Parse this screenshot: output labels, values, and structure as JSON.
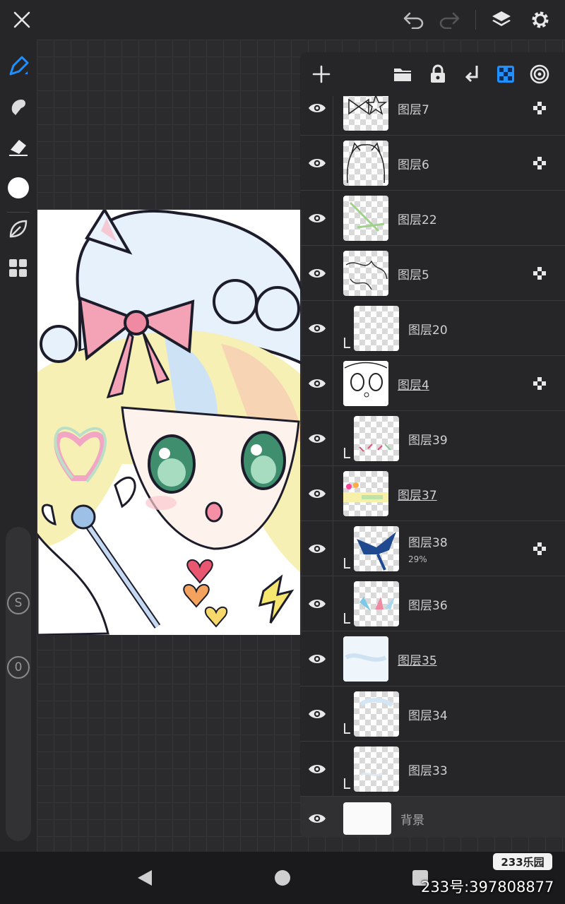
{
  "layers": [
    {
      "name": "图层7",
      "underline": false,
      "clipped": false,
      "alpha_lock": true,
      "thumb": "bow-star-sketch"
    },
    {
      "name": "图层6",
      "underline": false,
      "clipped": false,
      "alpha_lock": true,
      "thumb": "head-outline"
    },
    {
      "name": "图层22",
      "underline": false,
      "clipped": false,
      "alpha_lock": false,
      "thumb": "green-strokes"
    },
    {
      "name": "图层5",
      "underline": false,
      "clipped": false,
      "alpha_lock": true,
      "thumb": "hair-lineart"
    },
    {
      "name": "图层20",
      "underline": false,
      "clipped": true,
      "alpha_lock": false,
      "thumb": "empty"
    },
    {
      "name": "图层4",
      "underline": true,
      "clipped": false,
      "alpha_lock": true,
      "thumb": "face-lineart"
    },
    {
      "name": "图层39",
      "underline": false,
      "clipped": true,
      "alpha_lock": false,
      "thumb": "small-marks"
    },
    {
      "name": "图层37",
      "underline": true,
      "clipped": false,
      "alpha_lock": false,
      "thumb": "rainbow-hearts"
    },
    {
      "name": "图层38",
      "underline": false,
      "clipped": true,
      "alpha_lock": true,
      "thumb": "blue-bow",
      "opacity": "29%"
    },
    {
      "name": "图层36",
      "underline": false,
      "clipped": true,
      "alpha_lock": false,
      "thumb": "colored-wings"
    },
    {
      "name": "图层35",
      "underline": true,
      "clipped": false,
      "alpha_lock": false,
      "thumb": "light-blue"
    },
    {
      "name": "图层34",
      "underline": false,
      "clipped": true,
      "alpha_lock": false,
      "thumb": "light-blue-2"
    },
    {
      "name": "图层33",
      "underline": false,
      "clipped": true,
      "alpha_lock": false,
      "thumb": "faint"
    },
    {
      "name": "背景",
      "underline": false,
      "clipped": false,
      "alpha_lock": false,
      "thumb": "white-bg"
    }
  ],
  "icons": {
    "top": [
      "close-icon",
      "undo-icon",
      "redo-icon",
      "layers-icon",
      "settings-icon"
    ],
    "left": [
      "pen-icon",
      "smudge-icon",
      "eraser-icon",
      "color-icon",
      "leaf-icon",
      "grid-icon"
    ],
    "panel": [
      "add-layer-icon",
      "folder-icon",
      "lock-icon",
      "merge-down-icon",
      "alpha-lock-icon",
      "blend-icon"
    ],
    "nav": [
      "back-icon",
      "home-icon",
      "recent-icon"
    ]
  },
  "sliders": {
    "size_label": "S",
    "opacity_label": "0"
  },
  "accent_color": "#1e90ff",
  "watermark": {
    "logo": "233乐园",
    "id_text": "233号:397808877"
  }
}
